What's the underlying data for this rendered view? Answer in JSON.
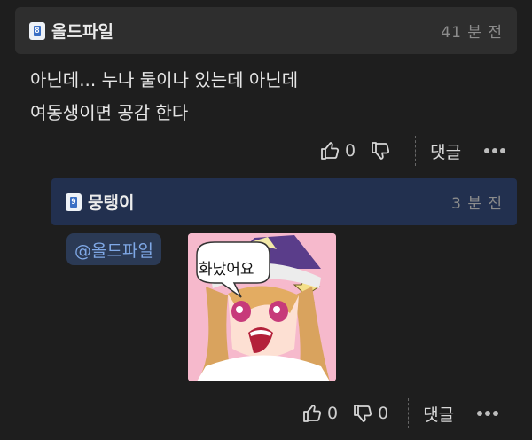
{
  "comments": [
    {
      "nickname": "올드파일",
      "level": "8",
      "time": "41 분 전",
      "lines": [
        "아닌데... 누나 둘이나 있는데 아닌데",
        "여동생이면 공감 한다"
      ],
      "likes": "0",
      "dislikes": "",
      "reply_label": "댓글"
    },
    {
      "nickname": "뭉탱이",
      "level": "9",
      "time": "3 분 전",
      "mention": "@올드파일",
      "sticker_text": "화났어요",
      "likes": "0",
      "dislikes": "0",
      "reply_label": "댓글"
    }
  ],
  "colors": {
    "background": "#1e1e1e",
    "comment_header": "#2e2e2e",
    "reply_header": "#22304f",
    "mention": "#7fa8e6"
  }
}
